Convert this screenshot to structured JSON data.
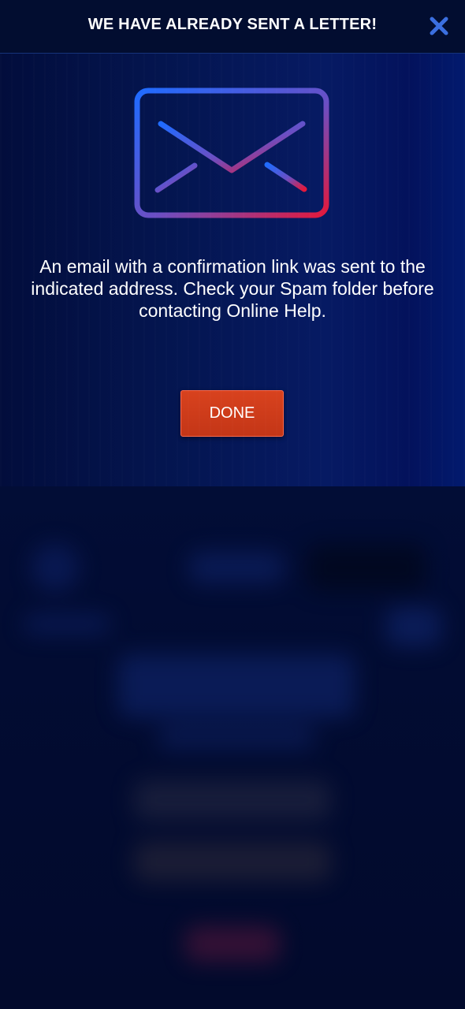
{
  "modal": {
    "title": "WE HAVE ALREADY SENT A LETTER!",
    "close_icon": "close-icon",
    "illustration_icon": "envelope-icon",
    "message": "An email with a confirmation link was sent to the indicated address. Check your Spam folder before contacting Online Help.",
    "done_label": "DONE"
  },
  "colors": {
    "header_bg": "#020d30",
    "close_icon": "#3b6fe0",
    "envelope_gradient_start": "#1f6bff",
    "envelope_gradient_end": "#e3193c",
    "done_button": "#c93a19",
    "modal_bg": "#04154f",
    "page_bg": "#020d36"
  }
}
